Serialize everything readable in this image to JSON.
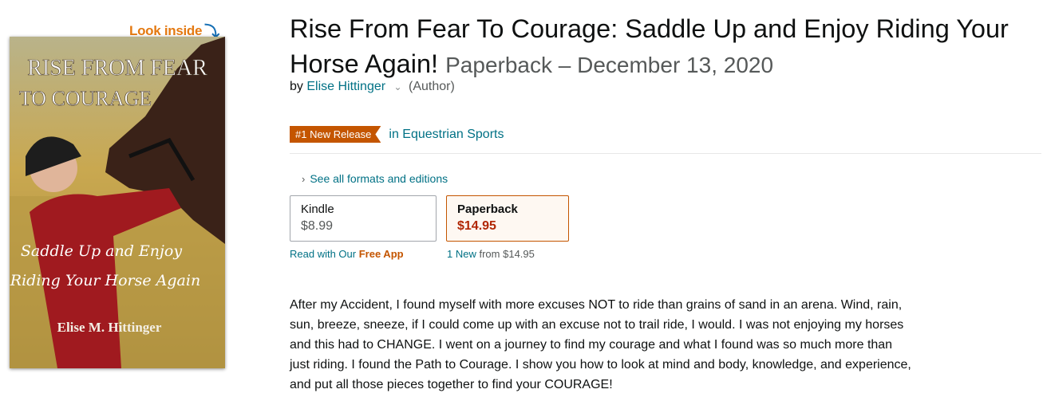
{
  "look_inside": {
    "label": "Look inside",
    "icon": "down-arrow-icon"
  },
  "cover": {
    "title_line1": "RISE FROM FEAR",
    "title_line2": "TO COURAGE",
    "subtitle_line1": "Saddle Up and Enjoy",
    "subtitle_line2": "Riding Your Horse Again",
    "author": "Elise M. Hittinger"
  },
  "product": {
    "title": "Rise From Fear To Courage: Saddle Up and Enjoy Riding Your Horse Again!",
    "format_date": "Paperback – December 13, 2020",
    "by_label": "by",
    "author": "Elise Hittinger",
    "author_role": "(Author)"
  },
  "badge": {
    "label": "#1 New Release",
    "category": "in Equestrian Sports"
  },
  "formats": {
    "see_all": "See all formats and editions",
    "kindle": {
      "label": "Kindle",
      "price": "$8.99",
      "sub_prefix": "Read with Our",
      "sub_link": "Free App"
    },
    "paperback": {
      "label": "Paperback",
      "price": "$14.95",
      "sub_new": "1 New",
      "sub_from": "from",
      "sub_price": "$14.95"
    }
  },
  "description": "After my Accident, I found myself with more excuses NOT to ride than grains of sand in an arena. Wind, rain, sun, breeze, sneeze, if I could come up with an excuse not to trail ride, I would. I was not enjoying my horses and this had to CHANGE. I went on a journey to find my courage and what I found was so much more than just riding. I found the Path to Courage. I show you how to look at mind and body, knowledge, and experience, and put all those pieces together to find your COURAGE!",
  "colors": {
    "accent_orange": "#c45500",
    "link_teal": "#007185",
    "price_red": "#b12704"
  }
}
